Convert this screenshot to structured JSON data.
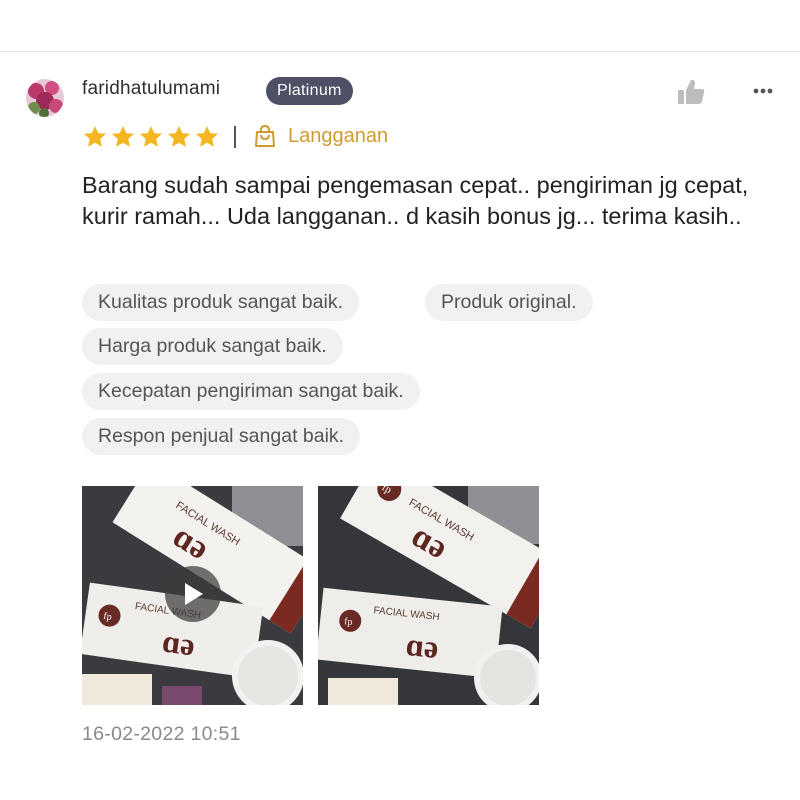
{
  "reviewer": {
    "username": "faridhatulumami",
    "badge": "Platinum"
  },
  "rating": {
    "stars": 5,
    "max_stars": 5,
    "star_color": "#f5b622",
    "label": "Langganan",
    "label_color": "#d29a2c"
  },
  "review_text": "Barang sudah sampai pengemasan cepat.. pengiriman jg cepat,  kurir ramah... Uda langganan.. d kasih bonus jg... terima kasih..",
  "tags": [
    "Kualitas produk sangat baik.",
    "Produk original.",
    "Harga produk sangat baik.",
    "Kecepatan pengiriman sangat baik.",
    "Respon penjual sangat baik."
  ],
  "media": [
    {
      "type": "video",
      "product_text": "FACIAL WASH"
    },
    {
      "type": "photo",
      "product_text": "FACIAL WASH"
    }
  ],
  "icons": {
    "like": "thumbs-up-icon",
    "more": "more-options-icon",
    "subscription": "shopping-bag-icon"
  },
  "timestamp": "16-02-2022 10:51"
}
